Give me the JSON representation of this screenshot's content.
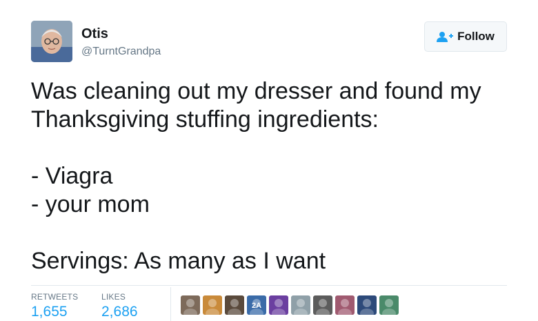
{
  "user": {
    "name": "Otis",
    "handle": "@TurntGrandpa"
  },
  "follow_button": {
    "label": "Follow",
    "icon": "add-user-icon",
    "color": "#1da1f2"
  },
  "tweet": {
    "text": "Was cleaning out my dresser and found my\nThanksgiving stuffing ingredients:\n\n- Viagra\n- your mom\n\nServings: As many as I want"
  },
  "stats": {
    "retweets_label": "RETWEETS",
    "retweets_value": "1,655",
    "likes_label": "LIKES",
    "likes_value": "2,686"
  },
  "likers": [
    {
      "avatar": "liker-avatar-1",
      "color": "#7d6a5a"
    },
    {
      "avatar": "liker-avatar-2",
      "color": "#c98a3a"
    },
    {
      "avatar": "liker-avatar-3",
      "color": "#5a4a3c"
    },
    {
      "avatar": "liker-avatar-4",
      "color": "#3a6ba8",
      "text": "2A"
    },
    {
      "avatar": "liker-avatar-5",
      "color": "#6b3fa0"
    },
    {
      "avatar": "liker-avatar-6",
      "color": "#8fa0a8"
    },
    {
      "avatar": "liker-avatar-7",
      "color": "#5c5c5c"
    },
    {
      "avatar": "liker-avatar-8",
      "color": "#a05a70"
    },
    {
      "avatar": "liker-avatar-9",
      "color": "#2d4a7a"
    },
    {
      "avatar": "liker-avatar-10",
      "color": "#4a8a6a"
    }
  ],
  "colors": {
    "accent": "#1da1f2",
    "text": "#14171a",
    "muted": "#657786"
  }
}
